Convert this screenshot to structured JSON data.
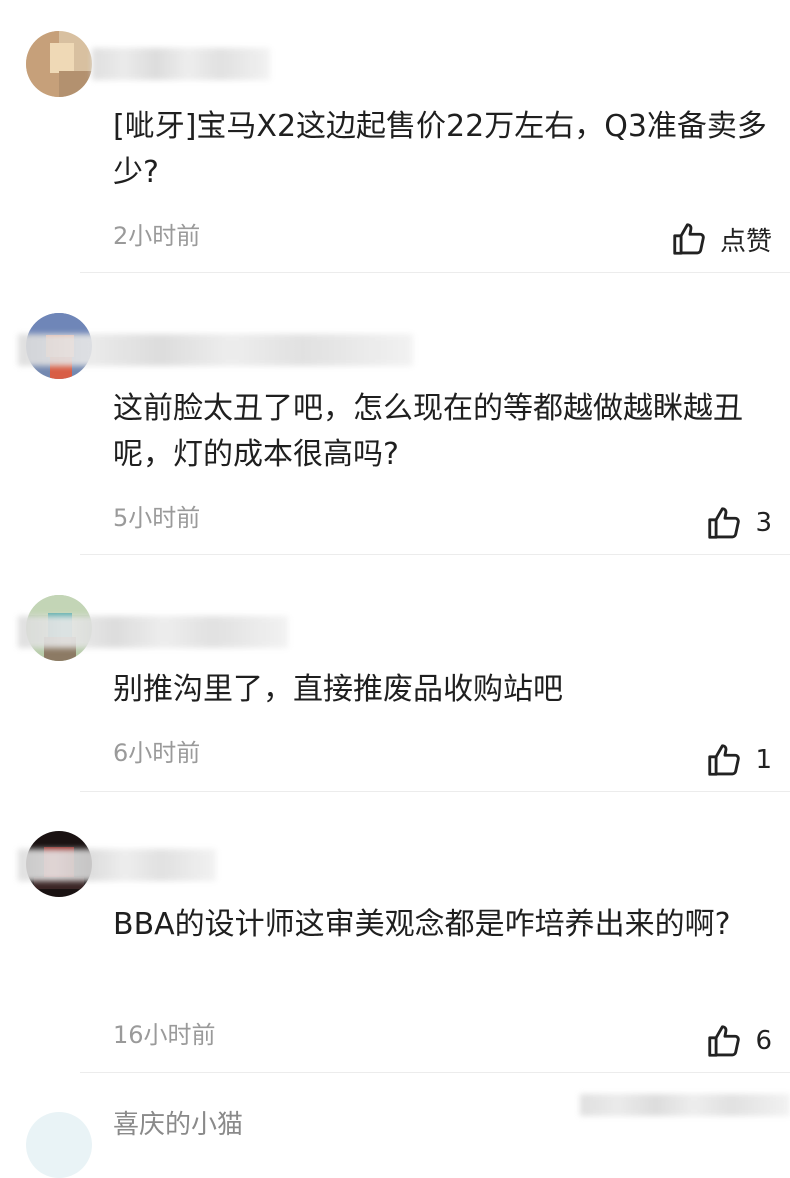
{
  "comments": [
    {
      "text": "[呲牙]宝马X2这边起售价22万左右，Q3准备卖多少?",
      "time": "2小时前",
      "likes": "点赞",
      "colors": [
        "#c9a882",
        "#e2c7a5",
        "#b89b7a"
      ]
    },
    {
      "text": "这前脸太丑了吧，怎么现在的等都越做越眯越丑呢，灯的成本很高吗?",
      "time": "5小时前",
      "likes": "3",
      "colors": [
        "#7a8fb5",
        "#e29a86",
        "#5f6f98"
      ]
    },
    {
      "text": "别推沟里了，直接推废品收购站吧",
      "time": "6小时前",
      "likes": "1",
      "colors": [
        "#a9c49a",
        "#6fb2ae",
        "#8a7a66"
      ]
    },
    {
      "text": "BBA的设计师这审美观念都是咋培养出来的啊?",
      "time": "16小时前",
      "likes": "6",
      "colors": [
        "#1b1212",
        "#8a1f1a",
        "#3a2020"
      ]
    }
  ],
  "partial_username": "喜庆的小猫"
}
